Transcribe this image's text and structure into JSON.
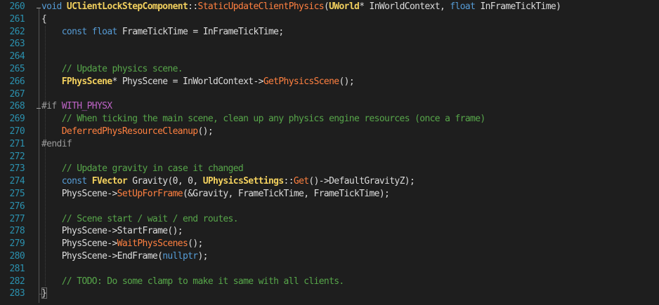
{
  "editor": {
    "theme": {
      "background": "#1e1e1e",
      "line_number_color": "#2b91af",
      "keyword_color": "#569cd6",
      "class_color": "#f2d05e",
      "function_color": "#ff8040",
      "comment_color": "#57a64a",
      "preprocessor_color": "#9b9b9b",
      "macro_color": "#bd63c5",
      "text_color": "#dcdcdc"
    },
    "line_numbers": [
      "260",
      "261",
      "262",
      "263",
      "264",
      "265",
      "266",
      "267",
      "268",
      "269",
      "270",
      "271",
      "272",
      "273",
      "274",
      "275",
      "276",
      "277",
      "278",
      "279",
      "280",
      "281",
      "282",
      "283"
    ],
    "lines": [
      [
        {
          "t": "void",
          "c": "kw"
        },
        {
          "t": " ",
          "c": "tx"
        },
        {
          "t": "UClientLockStepComponent",
          "c": "cls"
        },
        {
          "t": "::",
          "c": "tx"
        },
        {
          "t": "StaticUpdateClientPhysics",
          "c": "fn"
        },
        {
          "t": "(",
          "c": "tx"
        },
        {
          "t": "UWorld",
          "c": "cls"
        },
        {
          "t": "* InWorldContext, ",
          "c": "tx"
        },
        {
          "t": "float",
          "c": "kw"
        },
        {
          "t": " InFrameTickTime)",
          "c": "tx"
        }
      ],
      [
        {
          "t": "{",
          "c": "tx"
        }
      ],
      [
        {
          "t": "    ",
          "c": "tx"
        },
        {
          "t": "const",
          "c": "kw"
        },
        {
          "t": " ",
          "c": "tx"
        },
        {
          "t": "float",
          "c": "kw"
        },
        {
          "t": " FrameTickTime = InFrameTickTime;",
          "c": "tx"
        }
      ],
      [],
      [],
      [
        {
          "t": "    ",
          "c": "tx"
        },
        {
          "t": "// Update physics scene.",
          "c": "cm"
        }
      ],
      [
        {
          "t": "    ",
          "c": "tx"
        },
        {
          "t": "FPhysScene",
          "c": "cls"
        },
        {
          "t": "* PhysScene = InWorldContext->",
          "c": "tx"
        },
        {
          "t": "GetPhysicsScene",
          "c": "fn"
        },
        {
          "t": "();",
          "c": "tx"
        }
      ],
      [],
      [
        {
          "t": "#if ",
          "c": "pp"
        },
        {
          "t": "WITH_PHYSX",
          "c": "mac"
        }
      ],
      [
        {
          "t": "    ",
          "c": "tx"
        },
        {
          "t": "// When ticking the main scene, clean up any physics engine resources (once a frame)",
          "c": "cm"
        }
      ],
      [
        {
          "t": "    ",
          "c": "tx"
        },
        {
          "t": "DeferredPhysResourceCleanup",
          "c": "fn"
        },
        {
          "t": "();",
          "c": "tx"
        }
      ],
      [
        {
          "t": "#endif",
          "c": "pp"
        }
      ],
      [],
      [
        {
          "t": "    ",
          "c": "tx"
        },
        {
          "t": "// Update gravity in case it changed",
          "c": "cm"
        }
      ],
      [
        {
          "t": "    ",
          "c": "tx"
        },
        {
          "t": "const",
          "c": "kw"
        },
        {
          "t": " ",
          "c": "tx"
        },
        {
          "t": "FVector",
          "c": "cls"
        },
        {
          "t": " Gravity(0, 0, ",
          "c": "tx"
        },
        {
          "t": "UPhysicsSettings",
          "c": "cls"
        },
        {
          "t": "::",
          "c": "tx"
        },
        {
          "t": "Get",
          "c": "fn"
        },
        {
          "t": "()->DefaultGravityZ);",
          "c": "tx"
        }
      ],
      [
        {
          "t": "    PhysScene->",
          "c": "tx"
        },
        {
          "t": "SetUpForFrame",
          "c": "fn"
        },
        {
          "t": "(&Gravity, FrameTickTime, FrameTickTime);",
          "c": "tx"
        }
      ],
      [],
      [
        {
          "t": "    ",
          "c": "tx"
        },
        {
          "t": "// Scene start / wait / end routes.",
          "c": "cm"
        }
      ],
      [
        {
          "t": "    PhysScene->StartFrame();",
          "c": "tx"
        }
      ],
      [
        {
          "t": "    PhysScene->",
          "c": "tx"
        },
        {
          "t": "WaitPhysScenes",
          "c": "fn"
        },
        {
          "t": "();",
          "c": "tx"
        }
      ],
      [
        {
          "t": "    PhysScene->EndFrame(",
          "c": "tx"
        },
        {
          "t": "nullptr",
          "c": "kw"
        },
        {
          "t": ");",
          "c": "tx"
        }
      ],
      [],
      [
        {
          "t": "    ",
          "c": "tx"
        },
        {
          "t": "// TODO: Do some clamp to make it same with all clients.",
          "c": "cm"
        }
      ],
      [
        {
          "t": "}",
          "c": "tx"
        }
      ]
    ],
    "fold_markers": [
      "260",
      "268"
    ]
  }
}
